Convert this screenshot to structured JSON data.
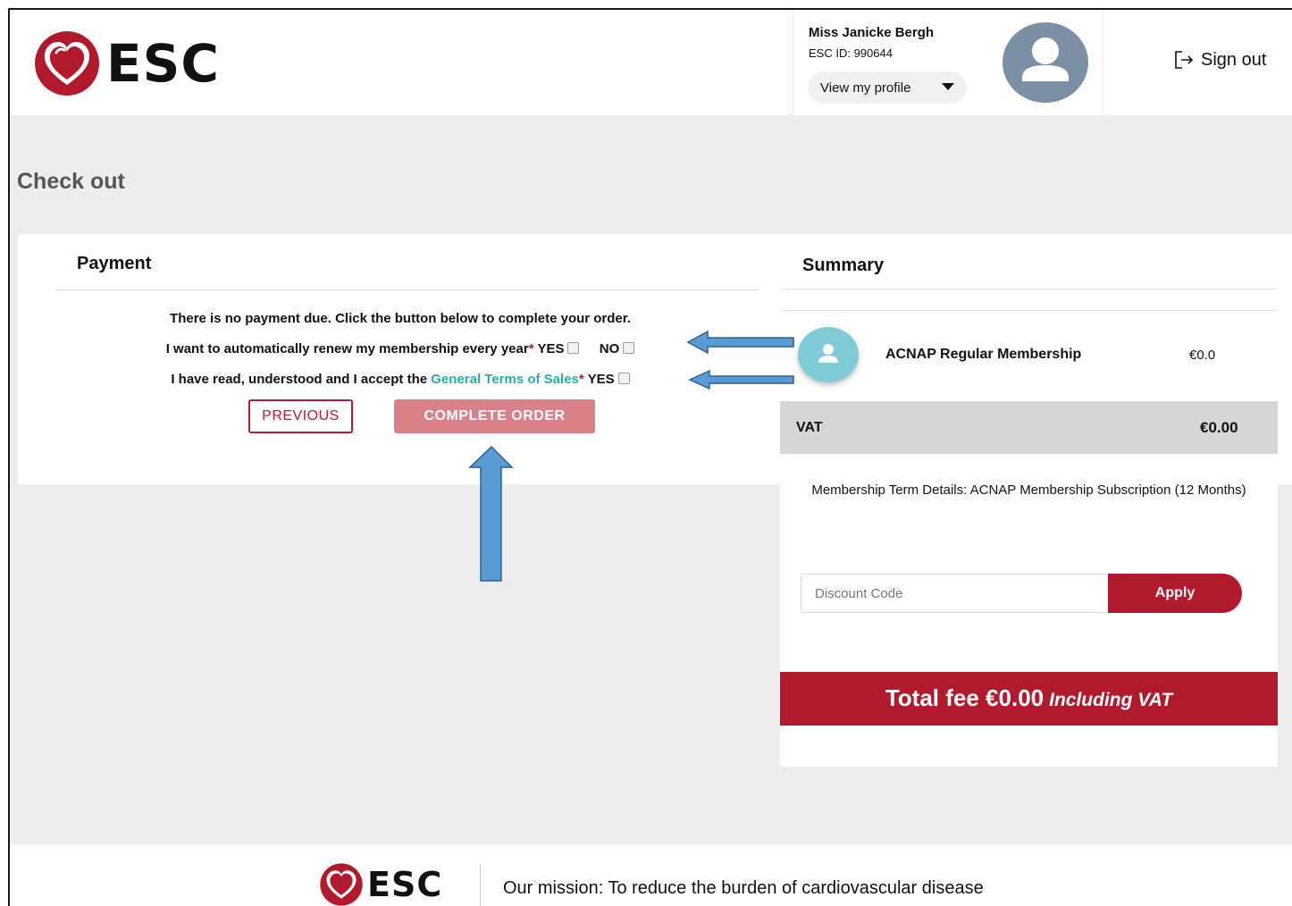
{
  "header": {
    "logo_text": "ESC",
    "user_name": "Miss Janicke Bergh",
    "user_id": "ESC ID: 990644",
    "view_profile_label": "View my profile",
    "sign_out_label": "Sign out"
  },
  "page": {
    "title": "Check out"
  },
  "payment": {
    "heading": "Payment",
    "notice": "There is no payment due. Click the button below to complete your order.",
    "renew_label": "I want to automatically renew my membership every year",
    "renew_required_mark": "*",
    "renew_yes": "YES",
    "renew_no": "NO",
    "terms_prefix": "I have read, understood and I accept the ",
    "terms_link": "General Terms of Sales",
    "terms_required_mark": "*",
    "terms_yes": "YES",
    "previous_label": "PREVIOUS",
    "complete_label": "COMPLETE ORDER"
  },
  "summary": {
    "heading": "Summary",
    "item_name": "ACNAP Regular Membership",
    "item_price": "€0.0",
    "vat_label": "VAT",
    "vat_value": "€0.00",
    "term_details": "Membership Term Details: ACNAP Membership Subscription (12 Months)",
    "discount_placeholder": "Discount Code",
    "apply_label": "Apply",
    "total_label": "Total fee €0.00",
    "total_note": "Including VAT"
  },
  "footer": {
    "logo_text": "ESC",
    "mission": "Our mission: To reduce the burden of cardiovascular disease"
  },
  "colors": {
    "brand_red": "#b01a2c",
    "complete_button": "#d98088",
    "link_teal": "#2eaca0",
    "annotation_arrow": "#5b9bd5"
  }
}
